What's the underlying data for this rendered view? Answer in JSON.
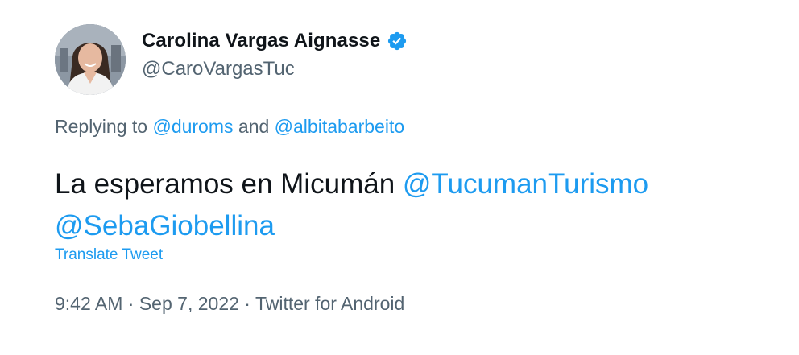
{
  "author": {
    "display_name": "Carolina Vargas Aignasse",
    "handle": "@CaroVargasTuc",
    "verified": true
  },
  "reply": {
    "prefix": "Replying to ",
    "mention_1": "@duroms",
    "joiner": " and ",
    "mention_2": "@albitabarbeito"
  },
  "body": {
    "text": "La esperamos en Micumán ",
    "mention_1": "@TucumanTurismo",
    "mention_2": "@SebaGiobellina"
  },
  "translate_label": "Translate Tweet",
  "meta": {
    "time": "9:42 AM",
    "separator_1": " · ",
    "date": "Sep 7, 2022",
    "separator_2": " · ",
    "source": "Twitter for Android"
  },
  "colors": {
    "link": "#1d9bf0",
    "secondary_text": "#536471",
    "primary_text": "#0f1419"
  },
  "icons": {
    "verified": "verified-badge-icon"
  }
}
